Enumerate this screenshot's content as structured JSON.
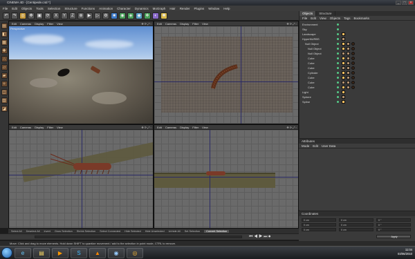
{
  "window": {
    "title": "CINEMA 4D - [Centipede.c4d *]"
  },
  "menu": [
    "File",
    "Edit",
    "Objects",
    "Tools",
    "Selection",
    "Structure",
    "Functions",
    "Animation",
    "Character",
    "Dynamics",
    "MoGraph",
    "Hair",
    "Render",
    "Plugins",
    "Window",
    "Help"
  ],
  "viewport_menu": [
    "Edit",
    "Cameras",
    "Display",
    "Filter",
    "View"
  ],
  "viewports": {
    "perspective_label": "Perspective"
  },
  "objects_panel": {
    "tabs": [
      "Objects",
      "Structure"
    ],
    "menu": [
      "File",
      "Edit",
      "View",
      "Objects",
      "Tags",
      "Bookmarks"
    ],
    "items": [
      {
        "name": "Environment",
        "indent": 0
      },
      {
        "name": "Sky",
        "indent": 0
      },
      {
        "name": "Landscape",
        "indent": 0
      },
      {
        "name": "HyperNURBS",
        "indent": 0
      },
      {
        "name": "Null Object",
        "indent": 1
      },
      {
        "name": "Null Object",
        "indent": 2
      },
      {
        "name": "Null Object",
        "indent": 2
      },
      {
        "name": "Cube",
        "indent": 2
      },
      {
        "name": "Cube",
        "indent": 2
      },
      {
        "name": "Cube",
        "indent": 2
      },
      {
        "name": "Cylinder",
        "indent": 2
      },
      {
        "name": "Cube",
        "indent": 2
      },
      {
        "name": "Cube",
        "indent": 2
      },
      {
        "name": "Cube",
        "indent": 2
      },
      {
        "name": "Light",
        "indent": 0
      },
      {
        "name": "Sphere",
        "indent": 0
      },
      {
        "name": "Spline",
        "indent": 0
      }
    ]
  },
  "attributes_panel": {
    "title": "Attributes",
    "menu": [
      "Mode",
      "Edit",
      "User Data"
    ]
  },
  "coordinates_panel": {
    "title": "Coordinates",
    "fields": [
      "0 cm",
      "0 cm",
      "0 cm",
      "0 cm",
      "0 cm",
      "0 cm",
      "0 °",
      "0 °",
      "0 °"
    ],
    "apply": "Apply"
  },
  "bottom_tabs": [
    "Select All",
    "Deselect All",
    "Invert",
    "Grow Selection",
    "Shrink Selection",
    "Select Connected",
    "Hide Selected",
    "Hide Unselected",
    "Unhide All",
    "Set Selection",
    "Convert Selection"
  ],
  "status": "Move: Click and drag to move elements. Hold down SHIFT to quantize movement / add to the selection in point mode, CTRL to remove.",
  "taskbar": {
    "time": "11:04",
    "date": "03/06/2010"
  }
}
